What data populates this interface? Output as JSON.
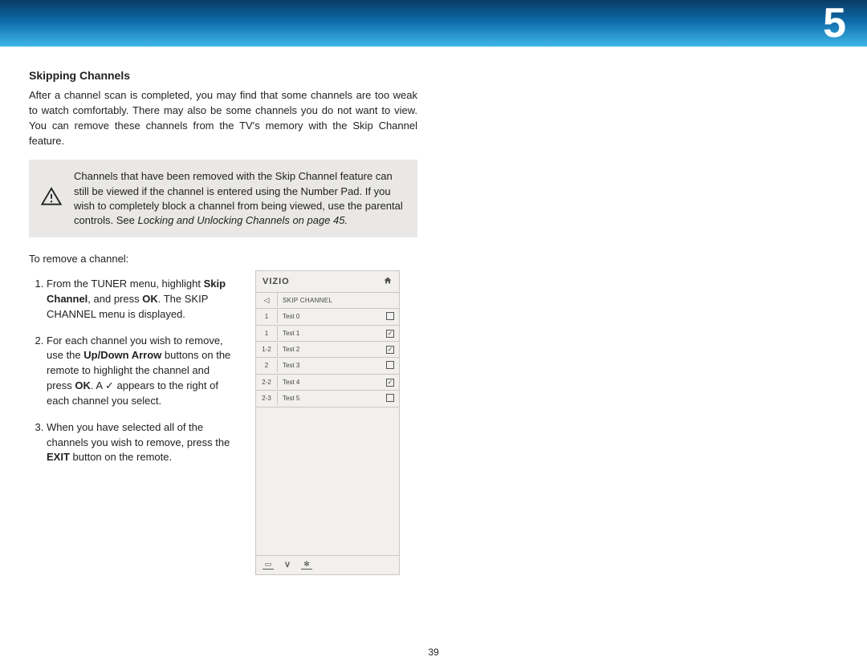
{
  "chapter_number": "5",
  "page_number": "39",
  "section_title": "Skipping Channels",
  "intro_paragraph": "After a channel scan is completed, you may find that some channels are too weak to watch comfortably. There may also be some channels you do not want to view. You can remove these channels from the TV's memory with the Skip Channel feature.",
  "warning": {
    "text_a": "Channels that have been removed with the Skip Channel feature can still be viewed if the channel is entered using the Number Pad. If you wish to completely block a channel from being viewed, use the parental controls. See ",
    "ref": "Locking and Unlocking Channels on page 45.",
    "icon": "warning-triangle"
  },
  "lead": "To remove a channel:",
  "steps": [
    {
      "pre": "From the TUNER menu, highlight ",
      "b1": "Skip Channel",
      "mid1": ", and press ",
      "b2": "OK",
      "post": ". The SKIP CHANNEL menu is displayed."
    },
    {
      "pre": "For each channel you wish to remove, use the ",
      "b1": "Up/Down Arrow",
      "mid1": " buttons on the remote to highlight the channel and press ",
      "b2": "OK",
      "post": ". A ✓ appears to the right of each channel you select."
    },
    {
      "pre": "When you have selected all of the channels you wish to remove, press the ",
      "b1": "EXIT",
      "post": " button on the remote."
    }
  ],
  "mock": {
    "brand": "VIZIO",
    "home_icon": "home",
    "back_icon": "◁",
    "subtitle": "SKIP CHANNEL",
    "rows": [
      {
        "num": "1",
        "label": "Test 0",
        "checked": false
      },
      {
        "num": "1",
        "label": "Test 1",
        "checked": true
      },
      {
        "num": "1-2",
        "label": "Test 2",
        "checked": true
      },
      {
        "num": "2",
        "label": "Test 3",
        "checked": false
      },
      {
        "num": "2-2",
        "label": "Test 4",
        "checked": true
      },
      {
        "num": "2-3",
        "label": "Test 5",
        "checked": false
      }
    ],
    "footer_icons": [
      "cc-icon",
      "v-icon",
      "gear-icon"
    ]
  }
}
